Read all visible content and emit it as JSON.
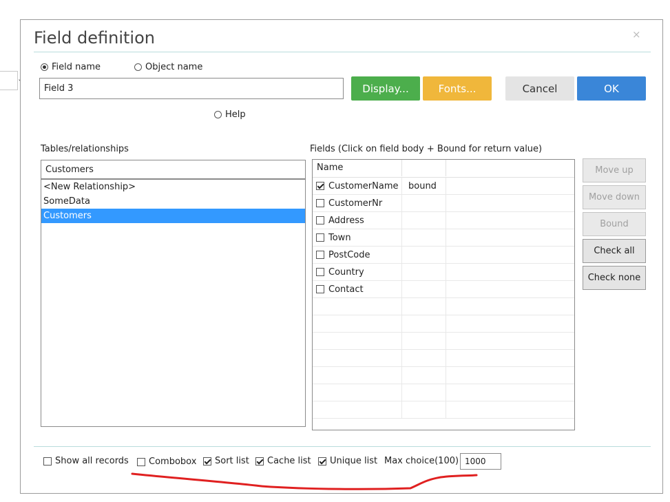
{
  "dialog": {
    "title": "Field definition",
    "close_glyph": "×"
  },
  "name_mode": {
    "field_name_label": "Field name",
    "object_name_label": "Object name",
    "selected": "field_name"
  },
  "name_input": {
    "value": "Field 3"
  },
  "help_label": "Help",
  "buttons": {
    "display": "Display...",
    "fonts": "Fonts...",
    "cancel": "Cancel",
    "ok": "OK"
  },
  "tables": {
    "label": "Tables/relationships",
    "current": "Customers",
    "items": [
      {
        "label": "<New Relationship>",
        "selected": false
      },
      {
        "label": "SomeData",
        "selected": false
      },
      {
        "label": "Customers",
        "selected": true
      }
    ]
  },
  "fields": {
    "label": "Fields (Click on field body + Bound for return value)",
    "header_name": "Name",
    "rows": [
      {
        "name": "CustomerName",
        "checked": true,
        "bound": "bound"
      },
      {
        "name": "CustomerNr",
        "checked": false,
        "bound": ""
      },
      {
        "name": "Address",
        "checked": false,
        "bound": ""
      },
      {
        "name": "Town",
        "checked": false,
        "bound": ""
      },
      {
        "name": "PostCode",
        "checked": false,
        "bound": ""
      },
      {
        "name": "Country",
        "checked": false,
        "bound": ""
      },
      {
        "name": "Contact",
        "checked": false,
        "bound": ""
      }
    ],
    "empty_rows": 7
  },
  "side_buttons": {
    "move_up": "Move up",
    "move_down": "Move down",
    "bound": "Bound",
    "check_all": "Check all",
    "check_none": "Check none"
  },
  "options": {
    "show_all_records": {
      "label": "Show all records",
      "checked": false
    },
    "combobox": {
      "label": "Combobox",
      "checked": false
    },
    "sort_list": {
      "label": "Sort list",
      "checked": true
    },
    "cache_list": {
      "label": "Cache list",
      "checked": true
    },
    "unique_list": {
      "label": "Unique list",
      "checked": true
    },
    "max_choice_label": "Max choice(100)",
    "max_choice_value": "1000"
  },
  "colors": {
    "display_button": "#4cae4c",
    "fonts_button": "#f0b73b",
    "ok_button": "#3a86d8",
    "selection": "#3399ff",
    "annotation_stroke": "#e02020"
  }
}
